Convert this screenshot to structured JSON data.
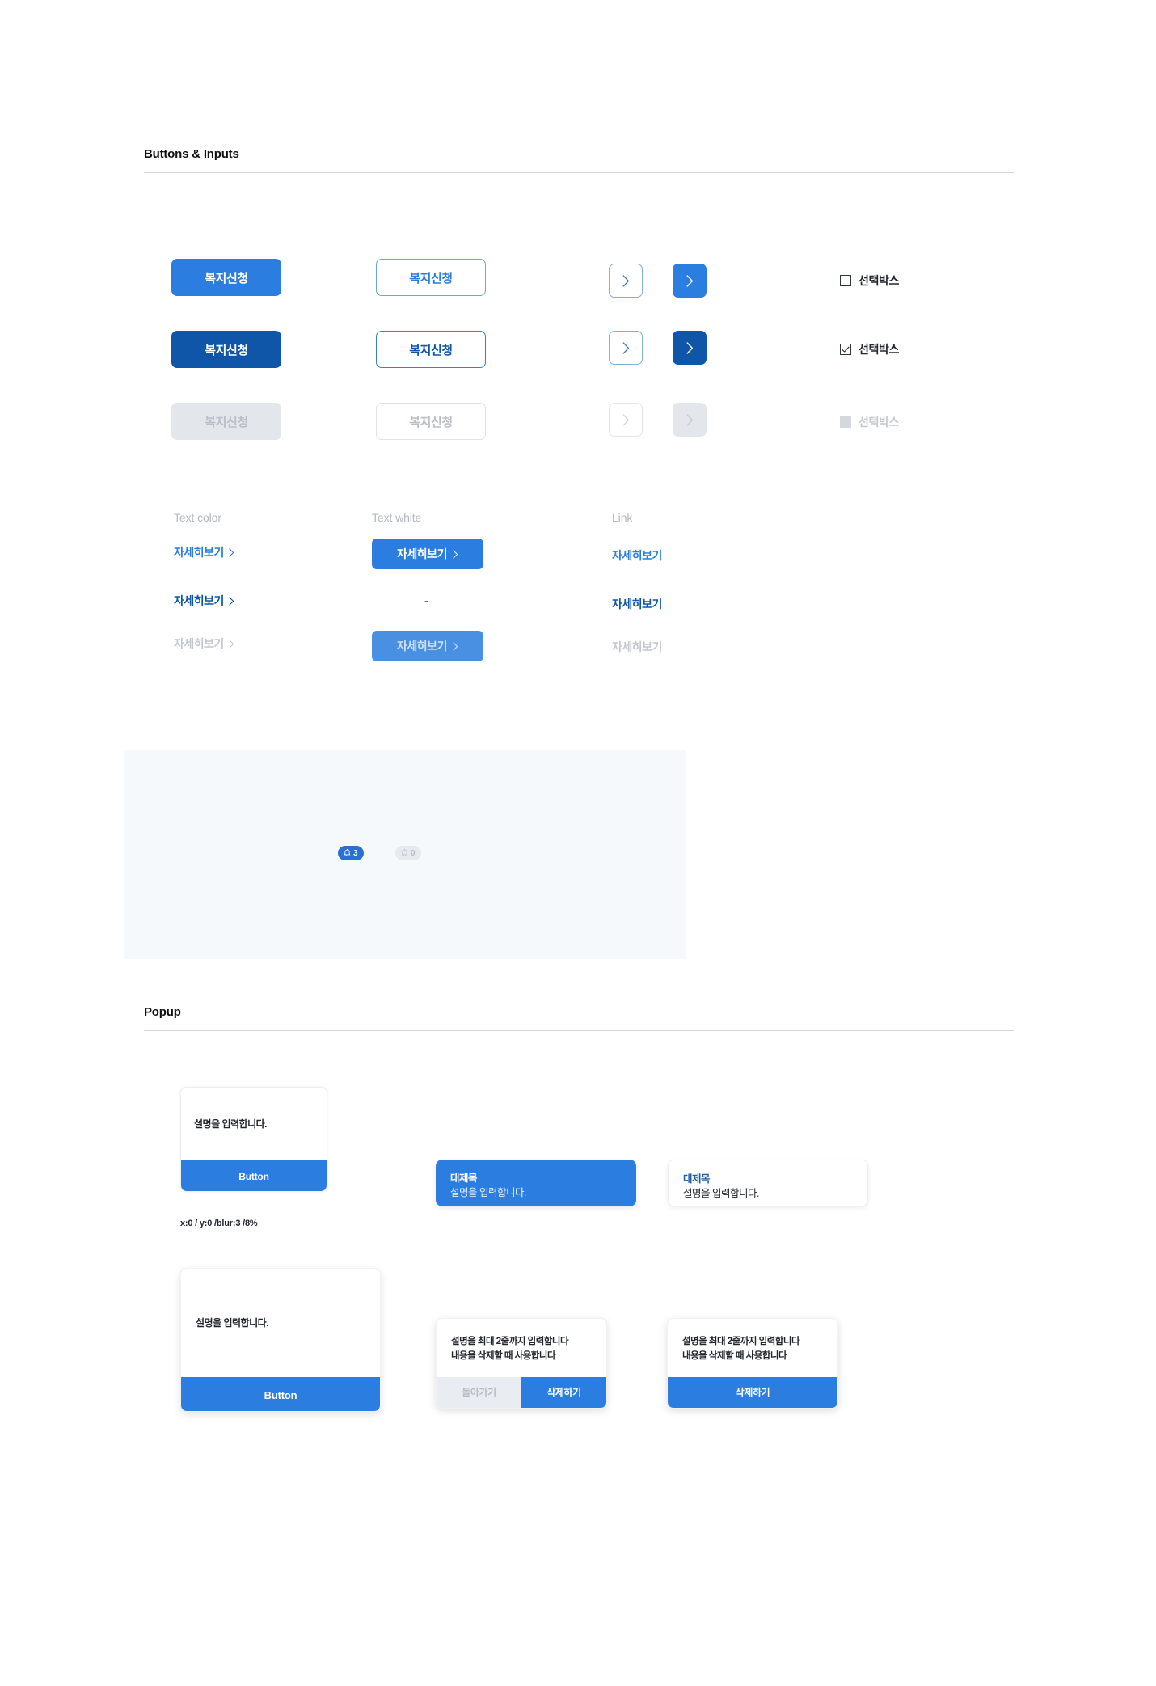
{
  "sections": {
    "buttons_inputs": {
      "title": "Buttons & Inputs"
    },
    "popup": {
      "title": "Popup"
    }
  },
  "buttons": {
    "label": "복지신청",
    "rows": [
      {
        "state": "default"
      },
      {
        "state": "hover"
      },
      {
        "state": "disabled"
      }
    ]
  },
  "arrow_buttons": {
    "icon": "chevron-right-icon",
    "rows": [
      {
        "outline": "default",
        "solid": "default"
      },
      {
        "outline": "hover",
        "solid": "hover"
      },
      {
        "outline": "disabled",
        "solid": "disabled"
      }
    ]
  },
  "checkboxes": {
    "label": "선택박스",
    "items": [
      {
        "state": "unchecked",
        "checked": false,
        "disabled": false
      },
      {
        "state": "checked",
        "checked": true,
        "disabled": false
      },
      {
        "state": "disabled",
        "checked": false,
        "disabled": true
      }
    ]
  },
  "text_columns": {
    "text_color": {
      "heading": "Text color",
      "items": [
        {
          "label": "자세히보기",
          "state": "default"
        },
        {
          "label": "자세히보기",
          "state": "hover"
        },
        {
          "label": "자세히보기",
          "state": "disabled"
        }
      ]
    },
    "text_white": {
      "heading": "Text white",
      "items": [
        {
          "label": "자세히보기",
          "state": "default"
        },
        {
          "label": "-",
          "state": "none"
        },
        {
          "label": "자세히보기",
          "state": "disabled"
        }
      ]
    },
    "link": {
      "heading": "Link",
      "items": [
        {
          "label": "자세히보기",
          "state": "default"
        },
        {
          "label": "자세히보기",
          "state": "hover"
        },
        {
          "label": "자세히보기",
          "state": "disabled"
        }
      ]
    }
  },
  "badges": {
    "icon": "bell-icon",
    "active": {
      "count": "3"
    },
    "inactive": {
      "count": "0"
    }
  },
  "popups": {
    "simple_small": {
      "description": "설명을 입력합니다.",
      "button": "Button",
      "caption": "x:0 / y:0 /blur:3 /8%"
    },
    "simple_large": {
      "description": "설명을 입력합니다.",
      "button": "Button"
    },
    "tip_blue": {
      "title": "대제목",
      "description": "설명을 입력합니다."
    },
    "tip_white": {
      "title": "대제목",
      "description": "설명을 입력합니다."
    },
    "confirm_two": {
      "line1": "설명을 최대 2줄까지 입력합니다",
      "line2": "내용을 삭제할 때 사용합니다",
      "cancel": "돌아가기",
      "confirm": "삭제하기"
    },
    "confirm_one": {
      "line1": "설명을 최대 2줄까지 입력합니다",
      "line2": "내용을 삭제할 때 사용합니다",
      "confirm": "삭제하기"
    }
  },
  "colors": {
    "primary": "#2b7de0",
    "primary_dark": "#0f56a8",
    "disabled_bg": "#e3e6eb",
    "disabled_text": "#b9bec7",
    "panel_bg": "#f6f9fc",
    "rule": "#d4d4d4"
  }
}
